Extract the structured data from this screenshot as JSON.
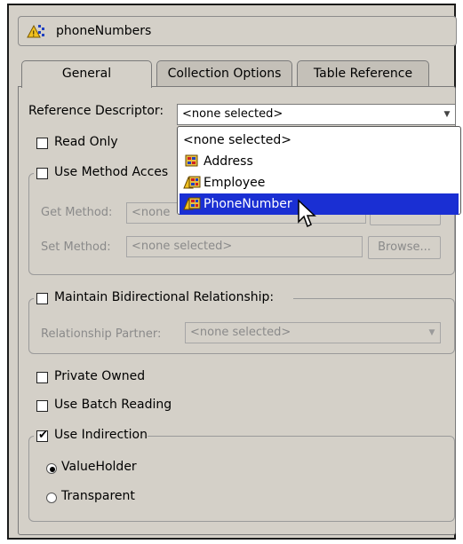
{
  "header": {
    "title": "phoneNumbers",
    "icon": "collection-mapping-icon"
  },
  "tabs": [
    {
      "label": "General",
      "active": true
    },
    {
      "label": "Collection Options",
      "active": false
    },
    {
      "label": "Table Reference",
      "active": false
    }
  ],
  "reference_descriptor": {
    "label": "Reference Descriptor:",
    "value": "<none selected>",
    "dropdown": {
      "open": true,
      "items": [
        {
          "label": "<none selected>",
          "icon": ""
        },
        {
          "label": "Address",
          "icon": "descriptor-icon"
        },
        {
          "label": "Employee",
          "icon": "descriptor-warning-icon"
        },
        {
          "label": "PhoneNumber",
          "icon": "descriptor-warning-icon",
          "selected": true
        }
      ]
    }
  },
  "read_only": {
    "label": "Read Only",
    "checked": false
  },
  "method_accessing": {
    "label": "Use Method Accessing",
    "visible_label": "Use Method Acces",
    "checked": false,
    "get_method": {
      "label": "Get Method:",
      "value": "<none"
    },
    "set_method": {
      "label": "Set Method:",
      "value": "<none selected>",
      "browse_label": "Browse..."
    }
  },
  "bidirectional": {
    "label": "Maintain Bidirectional Relationship:",
    "checked": false,
    "partner": {
      "label": "Relationship Partner:",
      "value": "<none selected>"
    }
  },
  "private_owned": {
    "label": "Private Owned",
    "checked": false
  },
  "batch_reading": {
    "label": "Use Batch Reading",
    "checked": false
  },
  "indirection": {
    "label": "Use Indirection",
    "checked": true,
    "options": [
      {
        "label": "ValueHolder",
        "selected": true
      },
      {
        "label": "Transparent",
        "selected": false
      }
    ]
  },
  "colors": {
    "selection": "#1a2fd3",
    "panel": "#d4d0c8",
    "disabled_text": "#8a8a8a"
  }
}
